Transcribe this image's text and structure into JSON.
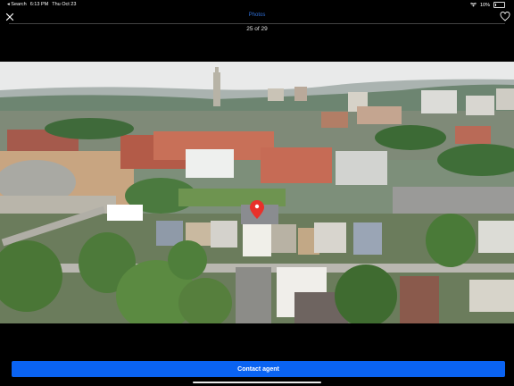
{
  "status_bar": {
    "back_app": "◂ Search",
    "time": "6:13 PM",
    "date": "Thu Oct 23",
    "battery": "10%"
  },
  "nav": {
    "title": "Photos",
    "counter": "25 of 29",
    "close_icon": "close-icon",
    "favorite_icon": "heart-icon"
  },
  "photo": {
    "description_icon": "aerial-city-photo",
    "pin_color": "#e8312a"
  },
  "cta": {
    "label": "Contact agent",
    "color": "#0a63f2"
  }
}
